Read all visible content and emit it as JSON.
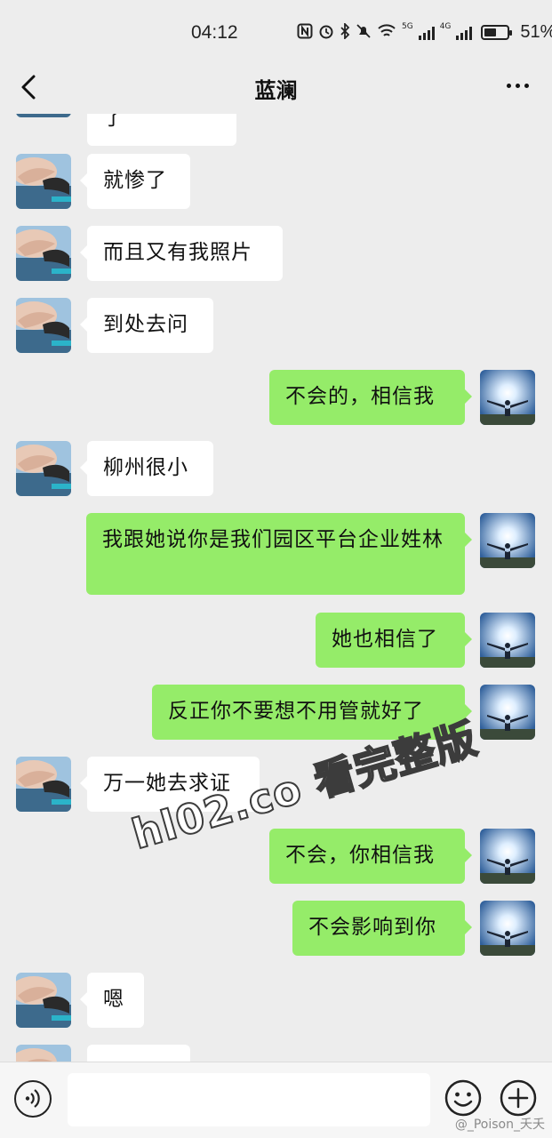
{
  "status_bar": {
    "time": "04:12",
    "network_5g": "5G",
    "network_4g": "4G",
    "battery_percent": "51%",
    "battery_level": 0.51,
    "icons": [
      "nfc-icon",
      "alarm-icon",
      "bluetooth-icon",
      "mute-icon",
      "wifi-icon",
      "signal-icon",
      "battery-icon"
    ]
  },
  "header": {
    "title": "蓝澜",
    "back_icon": "chevron-left-icon",
    "more_icon": "more-icon"
  },
  "messages": [
    {
      "side": "in",
      "text": "都只剩最后了"
    },
    {
      "side": "in",
      "text": "就惨了"
    },
    {
      "side": "in",
      "text": "而且又有我照片"
    },
    {
      "side": "in",
      "text": "到处去问"
    },
    {
      "side": "out",
      "text": "不会的，相信我"
    },
    {
      "side": "in",
      "text": "柳州很小"
    },
    {
      "side": "out",
      "text": "我跟她说你是我们园区平台企业姓林"
    },
    {
      "side": "out",
      "text": "她也相信了"
    },
    {
      "side": "out",
      "text": "反正你不要想不用管就好了"
    },
    {
      "side": "in",
      "text": "万一她去求证"
    },
    {
      "side": "out",
      "text": "不会，你相信我"
    },
    {
      "side": "out",
      "text": "不会影响到你"
    },
    {
      "side": "in",
      "text": "嗯"
    },
    {
      "side": "in",
      "text": ""
    }
  ],
  "input_bar": {
    "value": "",
    "placeholder": "",
    "voice_icon": "voice-icon",
    "emoji_icon": "emoji-icon",
    "plus_icon": "plus-icon"
  },
  "watermark": "hl02.co 看完整版",
  "credit": "@_Poison_夭夭",
  "colors": {
    "background": "#ededed",
    "incoming_bubble": "#ffffff",
    "outgoing_bubble": "#95ec69"
  }
}
